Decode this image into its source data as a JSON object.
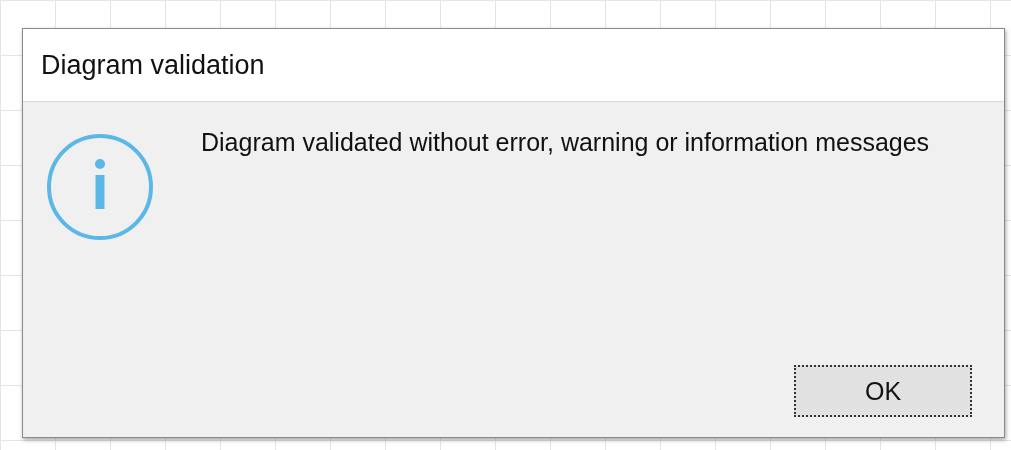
{
  "dialog": {
    "title": "Diagram validation",
    "message": "Diagram validated without error, warning or information messages",
    "buttons": [
      {
        "label": "OK",
        "focused": true
      }
    ]
  }
}
